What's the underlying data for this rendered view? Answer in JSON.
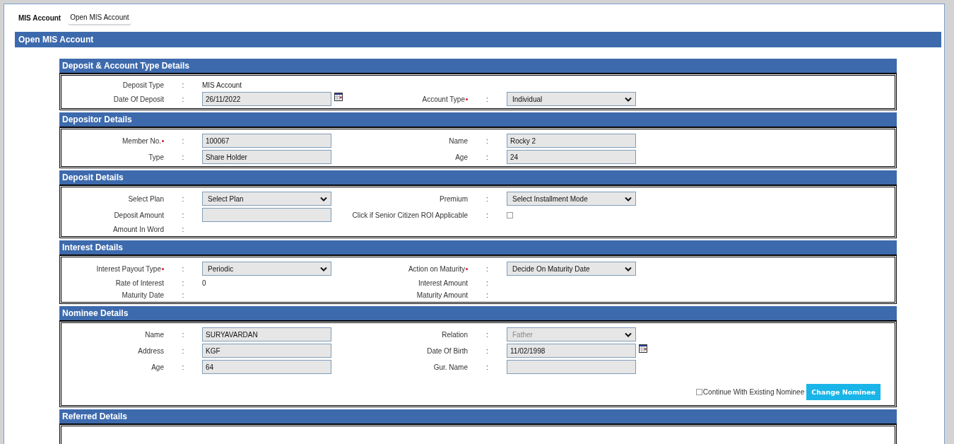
{
  "breadcrumb": [
    {
      "label": "MIS Account",
      "kind": "root"
    },
    {
      "label": "Open MIS Account",
      "kind": "current"
    }
  ],
  "page_title": "Open MIS Account",
  "sections": [
    {
      "title": "Deposit & Account Type Details",
      "rows": [
        [
          {
            "label": "Deposit Type",
            "colon": ":",
            "kind": "text",
            "value": "MIS Account"
          },
          {
            "kind": "empty"
          }
        ],
        [
          {
            "label": "Date Of Deposit",
            "colon": ":",
            "kind": "input",
            "value": "26/11/2022",
            "calendar": true
          },
          {
            "label": "Account Type",
            "colon": ":",
            "required": true,
            "kind": "select",
            "value": "Individual",
            "disabled": false
          }
        ]
      ]
    },
    {
      "title": "Depositor Details",
      "rows": [
        [
          {
            "label": "Member No.",
            "colon": ":",
            "required": true,
            "kind": "input",
            "value": "100067"
          },
          {
            "label": "Name",
            "colon": ":",
            "kind": "input",
            "value": "Rocky 2"
          }
        ],
        [
          {
            "label": "Type",
            "colon": ":",
            "kind": "input",
            "value": "Share Holder"
          },
          {
            "label": "Age",
            "colon": ":",
            "kind": "input",
            "value": "24"
          }
        ]
      ]
    },
    {
      "title": "Deposit Details",
      "rows": [
        [
          {
            "label": "Select Plan",
            "colon": ":",
            "kind": "select",
            "value": "Select Plan",
            "disabled": false
          },
          {
            "label": "Premium",
            "colon": ":",
            "kind": "select",
            "value": "Select Installment Mode",
            "disabled": false
          }
        ],
        [
          {
            "label": "Deposit Amount",
            "colon": ":",
            "kind": "input"
          },
          {
            "label": "Click if Senior Citizen ROI Applicable",
            "colon": ":",
            "kind": "checkbox",
            "checked": false
          }
        ],
        [
          {
            "label": "Amount In Word",
            "colon": ":",
            "kind": "text"
          },
          {
            "kind": "empty"
          }
        ]
      ]
    },
    {
      "title": "Interest Details",
      "rows": [
        [
          {
            "label": "Interest Payout Type",
            "colon": ":",
            "required": true,
            "kind": "select",
            "value": "Periodic",
            "disabled": false
          },
          {
            "label": "Action on Maturity",
            "colon": ":",
            "required": true,
            "kind": "select",
            "value": "Decide On Maturity Date",
            "disabled": false
          }
        ],
        [
          {
            "label": "Rate of Interest",
            "colon": ":",
            "kind": "text",
            "value": "0"
          },
          {
            "label": "Interest Amount",
            "colon": ":",
            "kind": "text"
          }
        ],
        [
          {
            "label": "Maturity Date",
            "colon": ":",
            "kind": "text"
          },
          {
            "label": "Maturity Amount",
            "colon": ":",
            "kind": "text"
          }
        ]
      ]
    },
    {
      "title": "Nominee Details",
      "rows": [
        [
          {
            "label": "Name",
            "colon": ":",
            "kind": "input",
            "value": "SURYAVARDAN"
          },
          {
            "label": "Relation",
            "colon": ":",
            "kind": "select",
            "value": "Father",
            "disabled": true
          }
        ],
        [
          {
            "label": "Address",
            "colon": ":",
            "kind": "input",
            "value": "KGF"
          },
          {
            "label": "Date Of Birth",
            "colon": ":",
            "kind": "input",
            "value": "11/02/1998",
            "calendar": true
          }
        ],
        [
          {
            "label": "Age",
            "colon": ":",
            "kind": "input",
            "value": "64"
          },
          {
            "label": "Gur. Name",
            "colon": ":",
            "kind": "input"
          }
        ]
      ],
      "footer": {
        "checkbox_label": "Continue With Existing Nominee",
        "checked": false,
        "button": "Change Nominee"
      }
    },
    {
      "title": "Referred Details"
    }
  ]
}
